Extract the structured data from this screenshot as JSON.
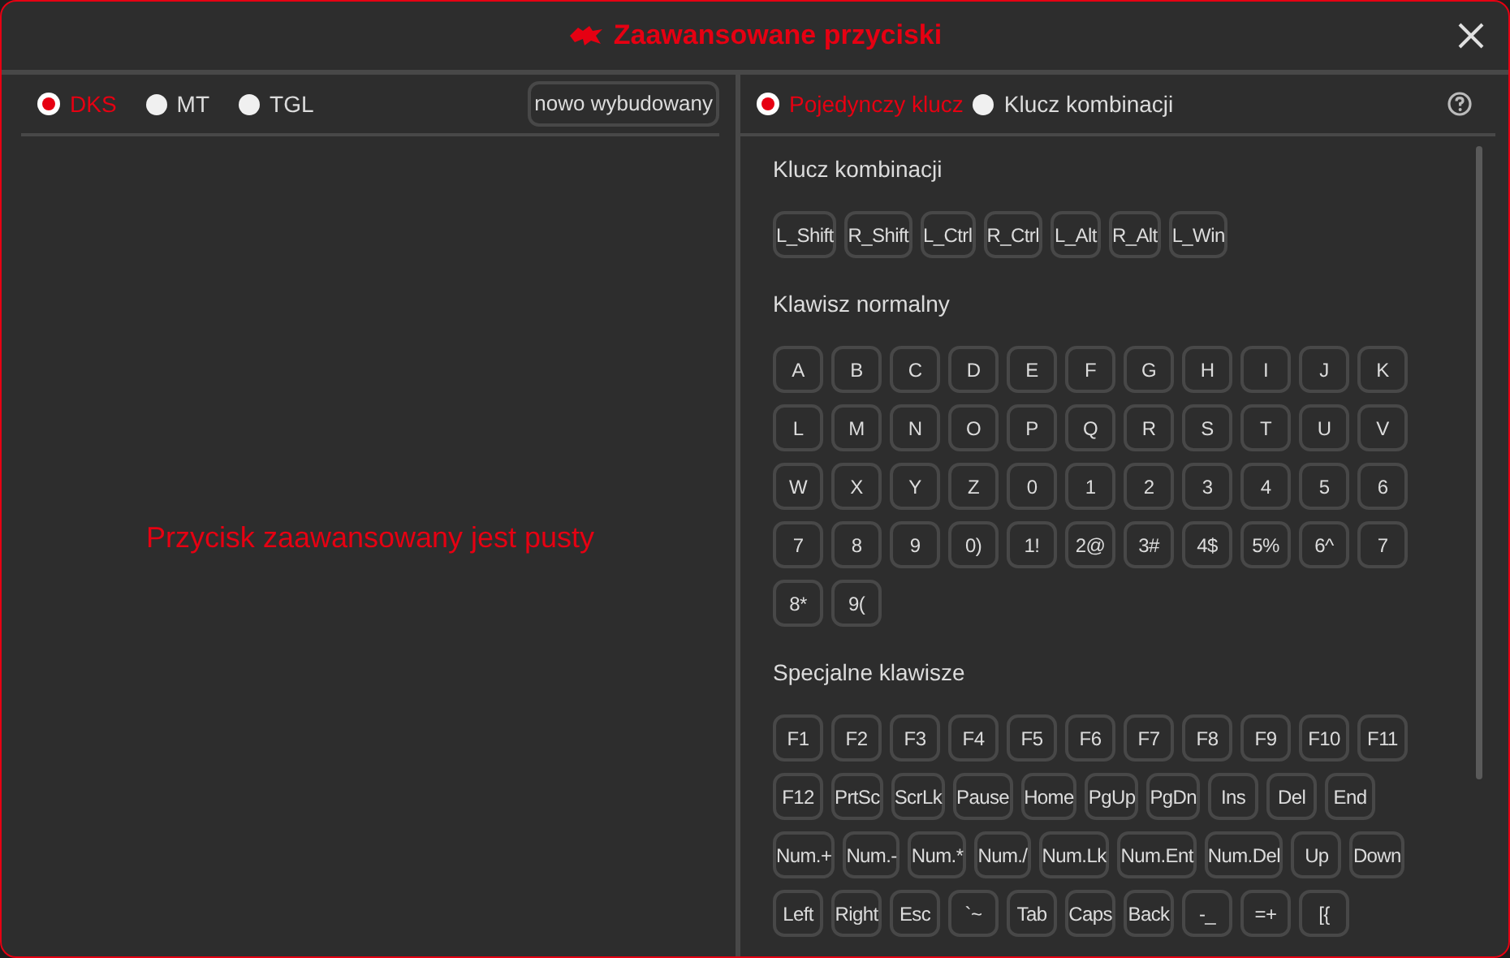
{
  "window": {
    "title": "Zaawansowane przyciski"
  },
  "modes": [
    {
      "label": "DKS",
      "selected": true
    },
    {
      "label": "MT",
      "selected": false
    },
    {
      "label": "TGL",
      "selected": false
    }
  ],
  "new_button": "nowo wybudowany",
  "empty_message": "Przycisk zaawansowany jest pusty",
  "key_types": [
    {
      "label": "Pojedynczy klucz",
      "selected": true
    },
    {
      "label": "Klucz kombinacji",
      "selected": false
    }
  ],
  "sections": [
    {
      "title": "Klucz kombinacji",
      "keys": [
        "L_Shift",
        "R_Shift",
        "L_Ctrl",
        "R_Ctrl",
        "L_Alt",
        "R_Alt",
        "L_Win"
      ]
    },
    {
      "title": "Klawisz normalny",
      "keys": [
        "A",
        "B",
        "C",
        "D",
        "E",
        "F",
        "G",
        "H",
        "I",
        "J",
        "K",
        "L",
        "M",
        "N",
        "O",
        "P",
        "Q",
        "R",
        "S",
        "T",
        "U",
        "V",
        "W",
        "X",
        "Y",
        "Z",
        "0",
        "1",
        "2",
        "3",
        "4",
        "5",
        "6",
        "7",
        "8",
        "9",
        "0)",
        "1!",
        "2@",
        "3#",
        "4$",
        "5%",
        "6^",
        "7",
        "8*",
        "9("
      ]
    },
    {
      "title": "Specjalne klawisze",
      "keys": [
        "F1",
        "F2",
        "F3",
        "F4",
        "F5",
        "F6",
        "F7",
        "F8",
        "F9",
        "F10",
        "F11",
        "F12",
        "PrtSc",
        "ScrLk",
        "Pause",
        "Home",
        "PgUp",
        "PgDn",
        "Ins",
        "Del",
        "End",
        "Num.+",
        "Num.-",
        "Num.*",
        "Num./",
        "Num.Lk",
        "Num.Ent",
        "Num.Del",
        "Up",
        "Down",
        "Left",
        "Right",
        "Esc",
        "`~",
        "Tab",
        "Caps",
        "Back",
        "-_",
        "=+",
        "[{"
      ]
    }
  ]
}
